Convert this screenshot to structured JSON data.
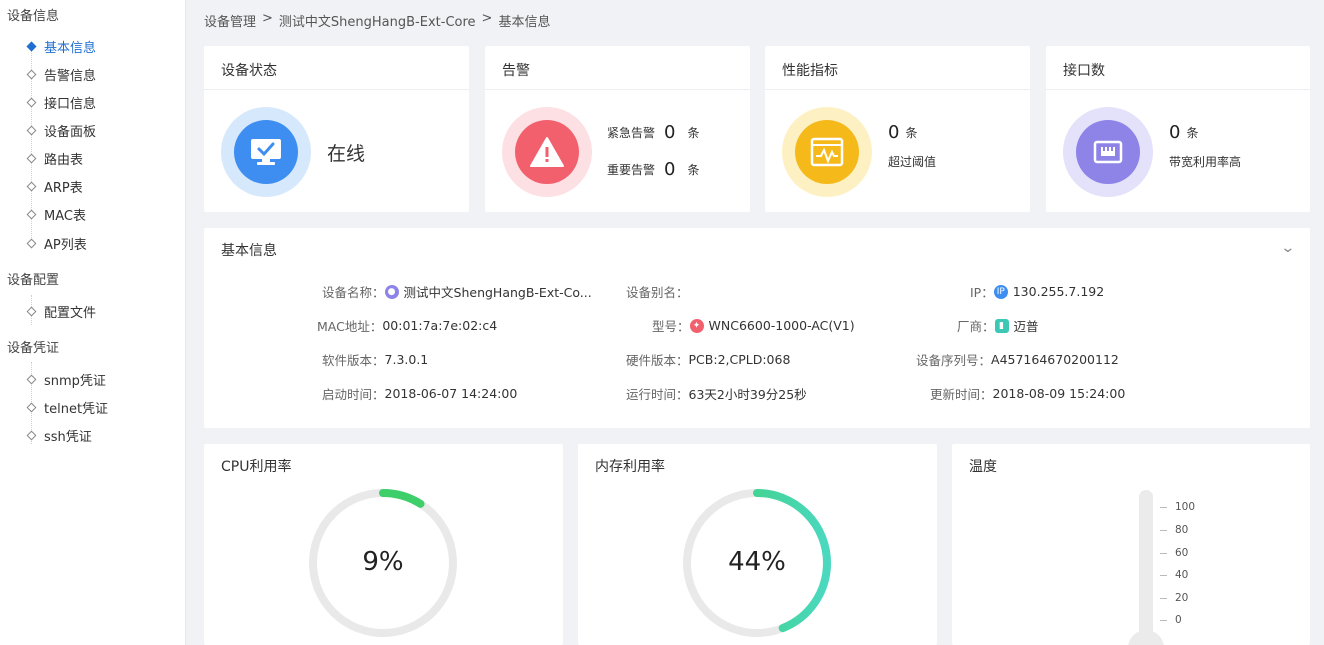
{
  "sidebar": {
    "groups": [
      {
        "title": "设备信息",
        "items": [
          "基本信息",
          "告警信息",
          "接口信息",
          "设备面板",
          "路由表",
          "ARP表",
          "MAC表",
          "AP列表"
        ]
      },
      {
        "title": "设备配置",
        "items": [
          "配置文件"
        ]
      },
      {
        "title": "设备凭证",
        "items": [
          "snmp凭证",
          "telnet凭证",
          "ssh凭证"
        ]
      }
    ],
    "active": "基本信息"
  },
  "breadcrumb": [
    "设备管理",
    ">",
    "测试中文ShengHangB-Ext-Core",
    ">",
    "基本信息"
  ],
  "status_card": {
    "title": "设备状态",
    "value": "在线",
    "icon": "monitor-check-icon",
    "color": "#3d8ef0"
  },
  "alarm_card": {
    "title": "告警",
    "icon": "warning-icon",
    "color": "#f2606e",
    "rows": [
      {
        "label": "紧急告警",
        "value": "0",
        "unit": "条"
      },
      {
        "label": "重要告警",
        "value": "0",
        "unit": "条"
      }
    ]
  },
  "perf_card": {
    "title": "性能指标",
    "icon": "chart-window-icon",
    "color": "#f5b91a",
    "value": "0",
    "unit": "条",
    "desc": "超过阈值"
  },
  "port_card": {
    "title": "接口数",
    "icon": "ethernet-port-icon",
    "color": "#8e84e8",
    "value": "0",
    "unit": "条",
    "desc": "带宽利用率高"
  },
  "basic_info": {
    "title": "基本信息",
    "fields": {
      "device_name_label": "设备名称：",
      "device_name": "测试中文ShengHangB-Ext-Co...",
      "alias_label": "设备别名：",
      "alias": "",
      "ip_label": "IP：",
      "ip": "130.255.7.192",
      "mac_label": "MAC地址：",
      "mac": "00:01:7a:7e:02:c4",
      "model_label": "型号：",
      "model": "WNC6600-1000-AC(V1)",
      "vendor_label": "厂商：",
      "vendor": "迈普",
      "sw_label": "软件版本：",
      "sw": "7.3.0.1",
      "hw_label": "硬件版本：",
      "hw": "PCB:2,CPLD:068",
      "serial_label": "设备序列号：",
      "serial": "A457164670200112",
      "boot_label": "启动时间：",
      "boot": "2018-06-07 14:24:00",
      "uptime_label": "运行时间：",
      "uptime": "63天2小时39分25秒",
      "update_label": "更新时间：",
      "update": "2018-08-09 15:24:00"
    }
  },
  "cpu": {
    "title": "CPU利用率",
    "label": "9%",
    "value": 9
  },
  "memory": {
    "title": "内存利用率",
    "label": "44%",
    "value": 44
  },
  "temperature": {
    "title": "温度",
    "ticks": [
      "100",
      "80",
      "60",
      "40",
      "20",
      "0"
    ]
  }
}
